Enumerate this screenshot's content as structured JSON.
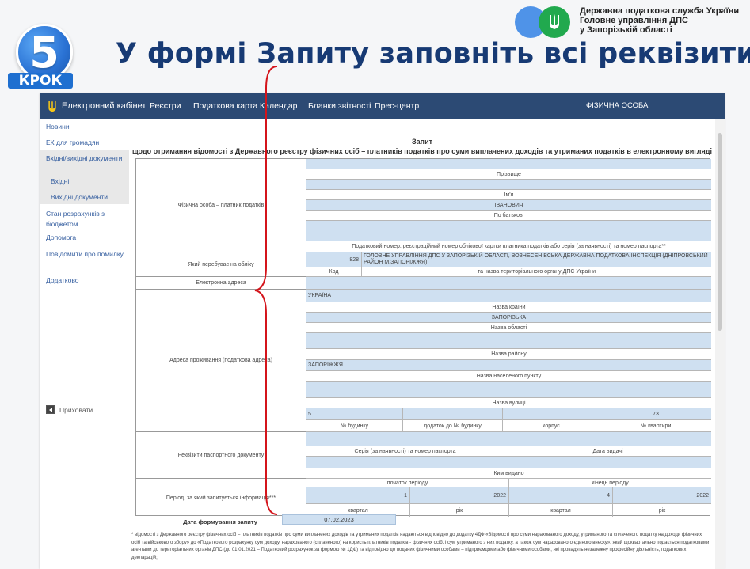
{
  "slide": {
    "step_number": "5",
    "step_label": "КРОК",
    "title": "У формі Запиту заповніть всі реквізити",
    "org_line1": "Державна податкова служба України",
    "org_line2": "Головне управління ДПС",
    "org_line3": "у Запорізькій області",
    "colors": {
      "title": "#173a74",
      "accent": "#2a72d4",
      "logo_blue": "#4f93e8",
      "logo_green": "#21a94e"
    }
  },
  "nav": {
    "brand": "Електронний кабінет",
    "links": [
      "Реєстри",
      "Податкова карта",
      "Календар",
      "Бланки звітності",
      "Прес-центр"
    ],
    "user": "ФІЗИЧНА ОСОБА",
    "color": "#2c4a74"
  },
  "sidebar": {
    "items": [
      "Новини",
      "ЕК для громадян",
      "Вхідні/вихідні документи",
      "Вхідні",
      "Вихідні документи",
      "Стан розрахунків з бюджетом",
      "Допомога",
      "Повідомити про помилку",
      "Додатково"
    ],
    "hide": "Приховати"
  },
  "form": {
    "heading": "Запит",
    "subheading": "щодо отримання відомості з Державного реєстру фізичних осіб – платників податків про суми виплачених доходів та утриманих податків в електронному вигляді",
    "taxpayer": {
      "label": "Фізична особа – платник податків",
      "surname_caption": "Прізвище",
      "name_caption": "Ім'я",
      "patronymic": "ІВАНОВИЧ",
      "patronymic_caption": "По батькові",
      "tax_number_caption": "Податковий номер: реєстраційний номер облікової картки платника податків або серія (за наявності) та номер паспорта**"
    },
    "registration": {
      "label": "Який перебуває на обліку",
      "code": "828",
      "authority": "ГОЛОВНЕ УПРАВЛІННЯ ДПС У ЗАПОРІЗЬКІЙ ОБЛАСТІ, ВОЗНЕСЕНІВСЬКА ДЕРЖАВНА ПОДАТКОВА ІНСПЕКЦІЯ (ДНІПРОВСЬКИЙ РАЙОН М.ЗАПОРІЖЖЯ)",
      "code_caption": "Код",
      "authority_caption": "та назва територіального органу ДПС України"
    },
    "email": {
      "label": "Електронна адреса"
    },
    "address": {
      "label": "Адреса проживання (податкова адреса)",
      "country": "УКРАЇНА",
      "country_caption": "Назва країни",
      "region": "ЗАПОРІЗЬКА",
      "region_caption": "Назва області",
      "district_caption": "Назва району",
      "city": "ЗАПОРІЖЖЯ",
      "city_caption": "Назва населеного пункту",
      "street_caption": "Назва вулиці",
      "house": "5",
      "apartment": "73",
      "house_caption": "№ будинку",
      "house_suffix_caption": "додаток до № будинку",
      "building_caption": "корпус",
      "apartment_caption": "№ квартири"
    },
    "passport": {
      "label": "Реквізити паспортного документу",
      "series_caption": "Серія (за наявності) та номер паспорта",
      "date_caption": "Дата видачі",
      "issued_caption": "Ким видано"
    },
    "period": {
      "label": "Період, за який запитується інформація***",
      "start_caption": "початок періоду",
      "end_caption": "кінець періоду",
      "start_quarter": "1",
      "start_year": "2022",
      "end_quarter": "4",
      "end_year": "2022",
      "quarter_caption": "квартал",
      "year_caption": "рік"
    },
    "date_label": "Дата формування запиту",
    "date_value": "07.02.2023",
    "footnote": "* відомості з Державного реєстру фізичних осіб – платників податків про суми виплачених доходів та утриманих податків надаються відповідно до додатку 4ДФ «Відомості про суми нарахованого доходу, утриманого та сплаченого податку на доходи фізичних осіб та військового збору» до «Податкового розрахунку сум доходу, нарахованого (сплаченого) на користь платників податків - фізичних осіб, і сум утриманого з них податку, а також сум нарахованого єдиного внеску», який щоквартально подається податковими агентами до територіальних органів ДПС (до 01.01.2021 – Податковий розрахунок за формою № 1ДФ) та відповідно до поданих фізичними особами – підприємцями або фізичними особами, які провадять незалежну професійну діяльність, податкових декларацій;"
  }
}
